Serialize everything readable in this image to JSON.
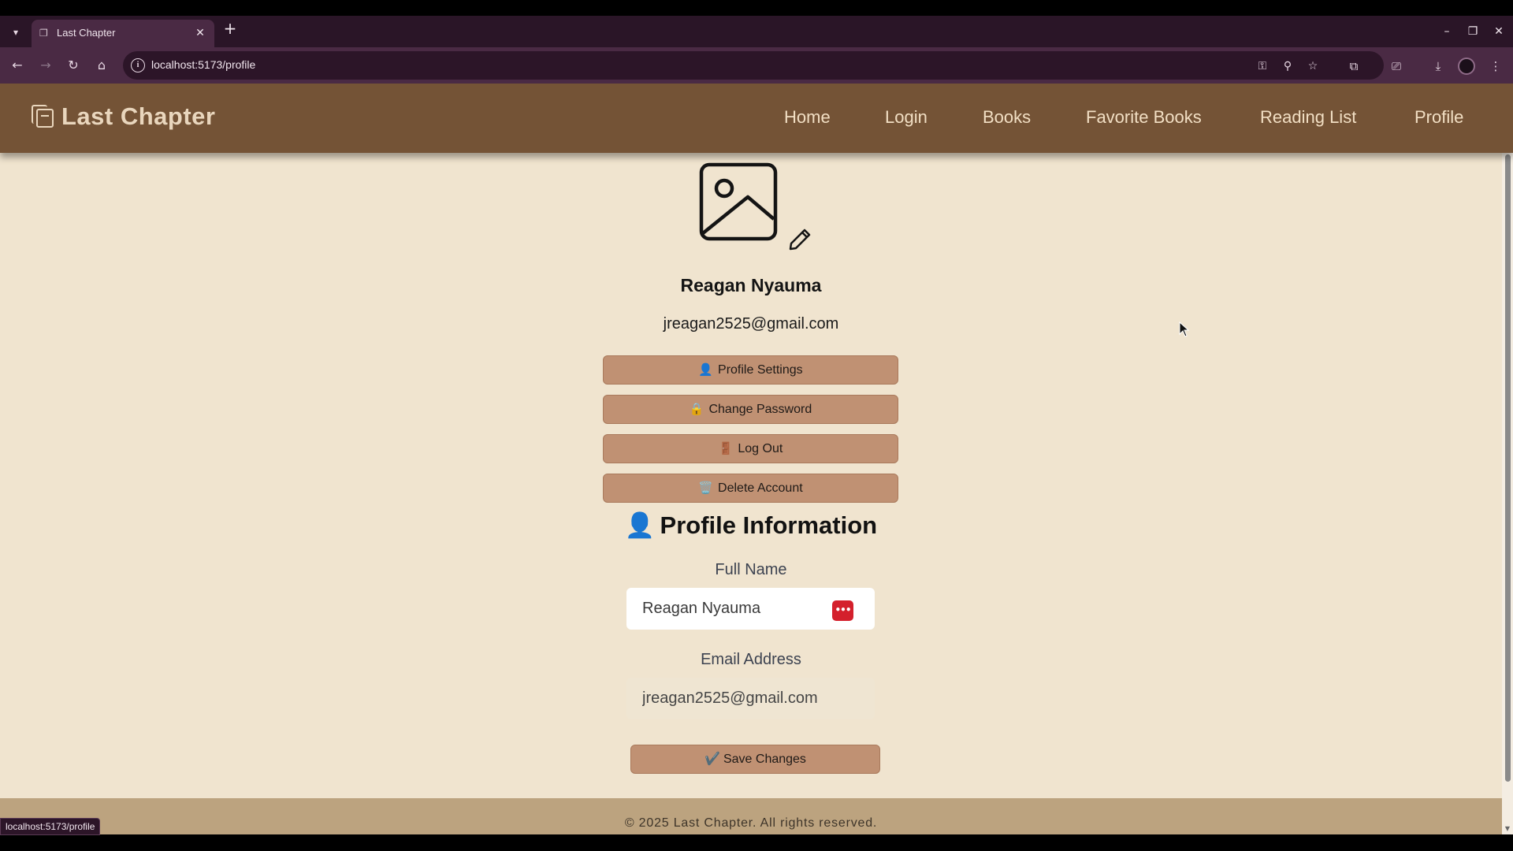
{
  "browser": {
    "tab_title": "Last Chapter",
    "url": "localhost:5173/profile",
    "status_url": "localhost:5173/profile"
  },
  "navbar": {
    "brand": "Last Chapter",
    "links": [
      "Home",
      "Login",
      "Books",
      "Favorite Books",
      "Reading List",
      "Profile"
    ]
  },
  "profile": {
    "name": "Reagan Nyauma",
    "email": "jreagan2525@gmail.com"
  },
  "actions": {
    "profile_settings": {
      "icon": "👤",
      "label": "Profile Settings"
    },
    "change_password": {
      "icon": "🔒",
      "label": "Change Password"
    },
    "log_out": {
      "icon": "🚪",
      "label": "Log Out"
    },
    "delete_account": {
      "icon": "🗑️",
      "label": "Delete Account"
    }
  },
  "form": {
    "title_icon": "👤",
    "title": "Profile Information",
    "full_name_label": "Full Name",
    "full_name_value": "Reagan Nyauma",
    "email_label": "Email Address",
    "email_value": "jreagan2525@gmail.com",
    "save_icon": "✔️",
    "save_label": "Save Changes"
  },
  "footer": {
    "text": "© 2025 Last Chapter. All rights reserved."
  },
  "colors": {
    "navbar": "#745336",
    "page_bg": "#f0e4cf",
    "button": "#c09173",
    "footer": "#bca37f"
  }
}
